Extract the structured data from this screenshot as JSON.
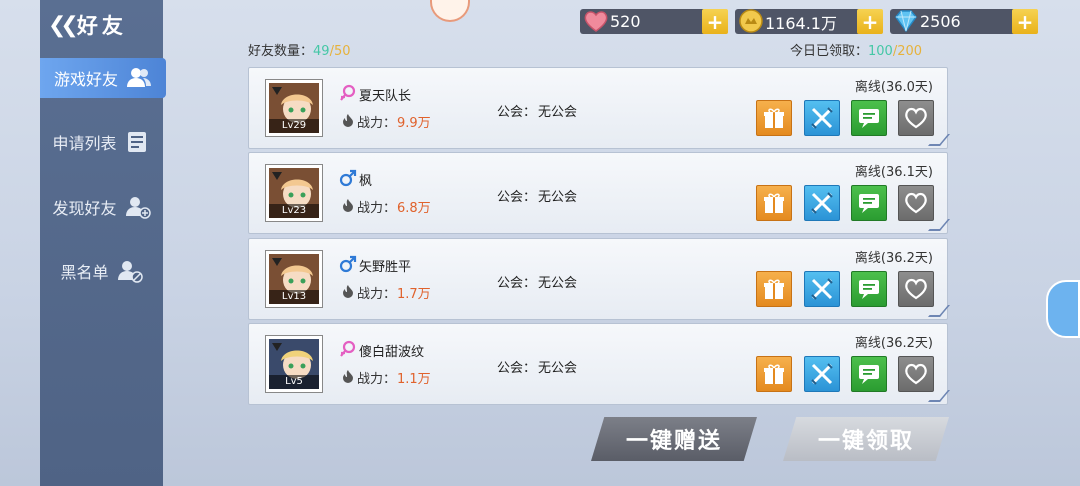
{
  "header": {
    "title": "好友",
    "back_icon": "double-chevron-left-icon"
  },
  "sidebar": {
    "items": [
      {
        "label": "游戏好友",
        "icon": "friends-icon",
        "active": true
      },
      {
        "label": "申请列表",
        "icon": "list-icon",
        "active": false
      },
      {
        "label": "发现好友",
        "icon": "add-user-icon",
        "active": false
      },
      {
        "label": "黑名单",
        "icon": "block-user-icon",
        "active": false
      }
    ]
  },
  "resources": {
    "stamina": {
      "value": "520",
      "icon": "heart-icon"
    },
    "gold": {
      "value": "1164.1万",
      "icon": "coin-icon"
    },
    "diamond": {
      "value": "2506",
      "icon": "diamond-icon"
    },
    "plus": "+"
  },
  "counts": {
    "friend_label": "好友数量：",
    "friend_current": "49",
    "friend_sep": "/",
    "friend_max": "50",
    "claim_label": "今日已领取：",
    "claim_current": "100",
    "claim_sep": "/",
    "claim_max": "200"
  },
  "labels": {
    "power": "战力：",
    "guild": "公会："
  },
  "friends": [
    {
      "name": "夏天队长",
      "gender": "female",
      "level": "Lv29",
      "power": "9.9万",
      "guild": "无公会",
      "status": "离线(36.0天)"
    },
    {
      "name": "枫",
      "gender": "male",
      "level": "Lv23",
      "power": "6.8万",
      "guild": "无公会",
      "status": "离线(36.1天)"
    },
    {
      "name": "矢野胜平",
      "gender": "male",
      "level": "Lv13",
      "power": "1.7万",
      "guild": "无公会",
      "status": "离线(36.2天)"
    },
    {
      "name": "傻白甜波纹",
      "gender": "female",
      "level": "Lv5",
      "power": "1.1万",
      "guild": "无公会",
      "status": "离线(36.2天)"
    }
  ],
  "buttons": {
    "send_all": "一键赠送",
    "claim_all": "一键领取"
  },
  "colors": {
    "female": "#e45fc2",
    "male": "#2f7ad6",
    "power": "#e0622c",
    "count_current": "#45c7a6",
    "count_max": "#e6b23c"
  }
}
